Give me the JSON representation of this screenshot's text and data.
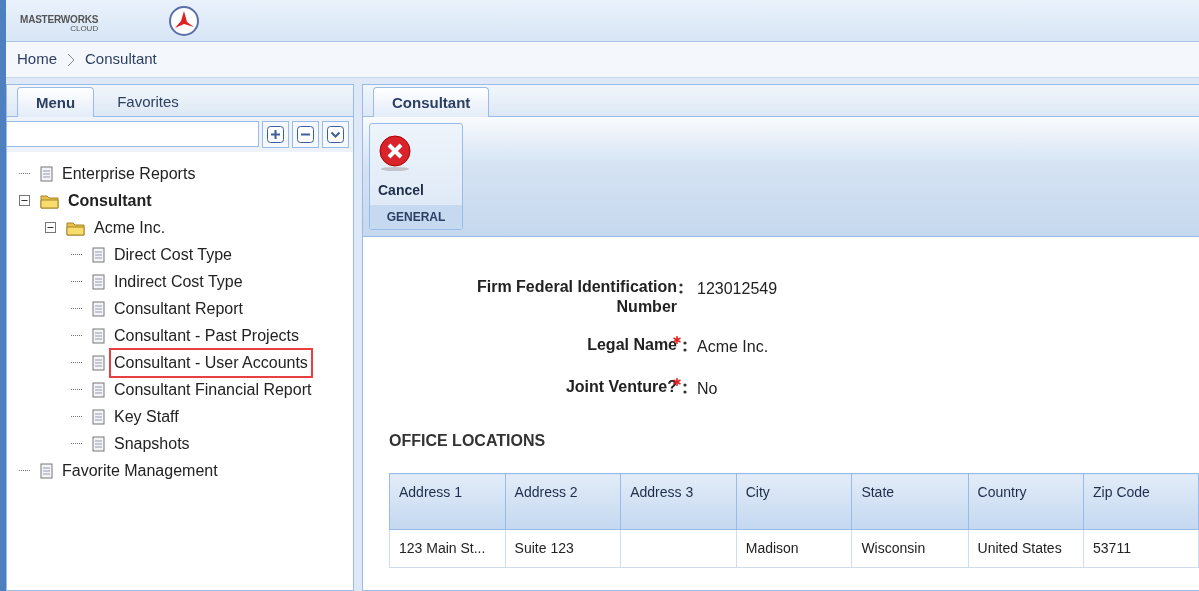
{
  "logo": {
    "wordmark": "MASTERWORKS",
    "subtitle": "CLOUD"
  },
  "breadcrumb": [
    {
      "label": "Home"
    },
    {
      "label": "Consultant"
    }
  ],
  "left_tabs": [
    {
      "label": "Menu",
      "selected": true
    },
    {
      "label": "Favorites",
      "selected": false
    }
  ],
  "tree": [
    {
      "label": "Enterprise Reports",
      "kind": "page",
      "bold": false,
      "highlighted": false
    },
    {
      "label": "Consultant",
      "kind": "folder",
      "bold": true,
      "expanded": true,
      "highlighted": false,
      "children": [
        {
          "label": "Acme Inc.",
          "kind": "folder",
          "bold": false,
          "expanded": true,
          "highlighted": false,
          "children": [
            {
              "label": "Direct Cost Type",
              "kind": "page",
              "bold": false,
              "highlighted": false
            },
            {
              "label": "Indirect Cost Type",
              "kind": "page",
              "bold": false,
              "highlighted": false
            },
            {
              "label": "Consultant Report",
              "kind": "page",
              "bold": false,
              "highlighted": false
            },
            {
              "label": "Consultant - Past Projects",
              "kind": "page",
              "bold": false,
              "highlighted": false
            },
            {
              "label": "Consultant - User Accounts",
              "kind": "page",
              "bold": false,
              "highlighted": true
            },
            {
              "label": "Consultant Financial Report",
              "kind": "page",
              "bold": false,
              "highlighted": false
            },
            {
              "label": "Key Staff",
              "kind": "page",
              "bold": false,
              "highlighted": false
            },
            {
              "label": "Snapshots",
              "kind": "page",
              "bold": false,
              "highlighted": false
            }
          ]
        }
      ]
    },
    {
      "label": "Favorite Management",
      "kind": "page",
      "bold": false,
      "highlighted": false
    }
  ],
  "right_tabs": [
    {
      "label": "Consultant",
      "selected": true
    }
  ],
  "ribbon": {
    "buttons": [
      {
        "label": "Cancel"
      }
    ],
    "group": "GENERAL"
  },
  "form": [
    {
      "label": "Firm Federal Identification Number",
      "required": false,
      "value": "123012549"
    },
    {
      "label": "Legal Name",
      "required": true,
      "value": "Acme Inc."
    },
    {
      "label": "Joint Venture?",
      "required": true,
      "value": "No"
    }
  ],
  "section_title": "OFFICE LOCATIONS",
  "table": {
    "columns": [
      "Address 1",
      "Address 2",
      "Address 3",
      "City",
      "State",
      "Country",
      "Zip Code"
    ],
    "rows": [
      [
        "123 Main St...",
        "Suite 123",
        "",
        "Madison",
        "Wisconsin",
        "United States",
        "53711"
      ]
    ]
  }
}
